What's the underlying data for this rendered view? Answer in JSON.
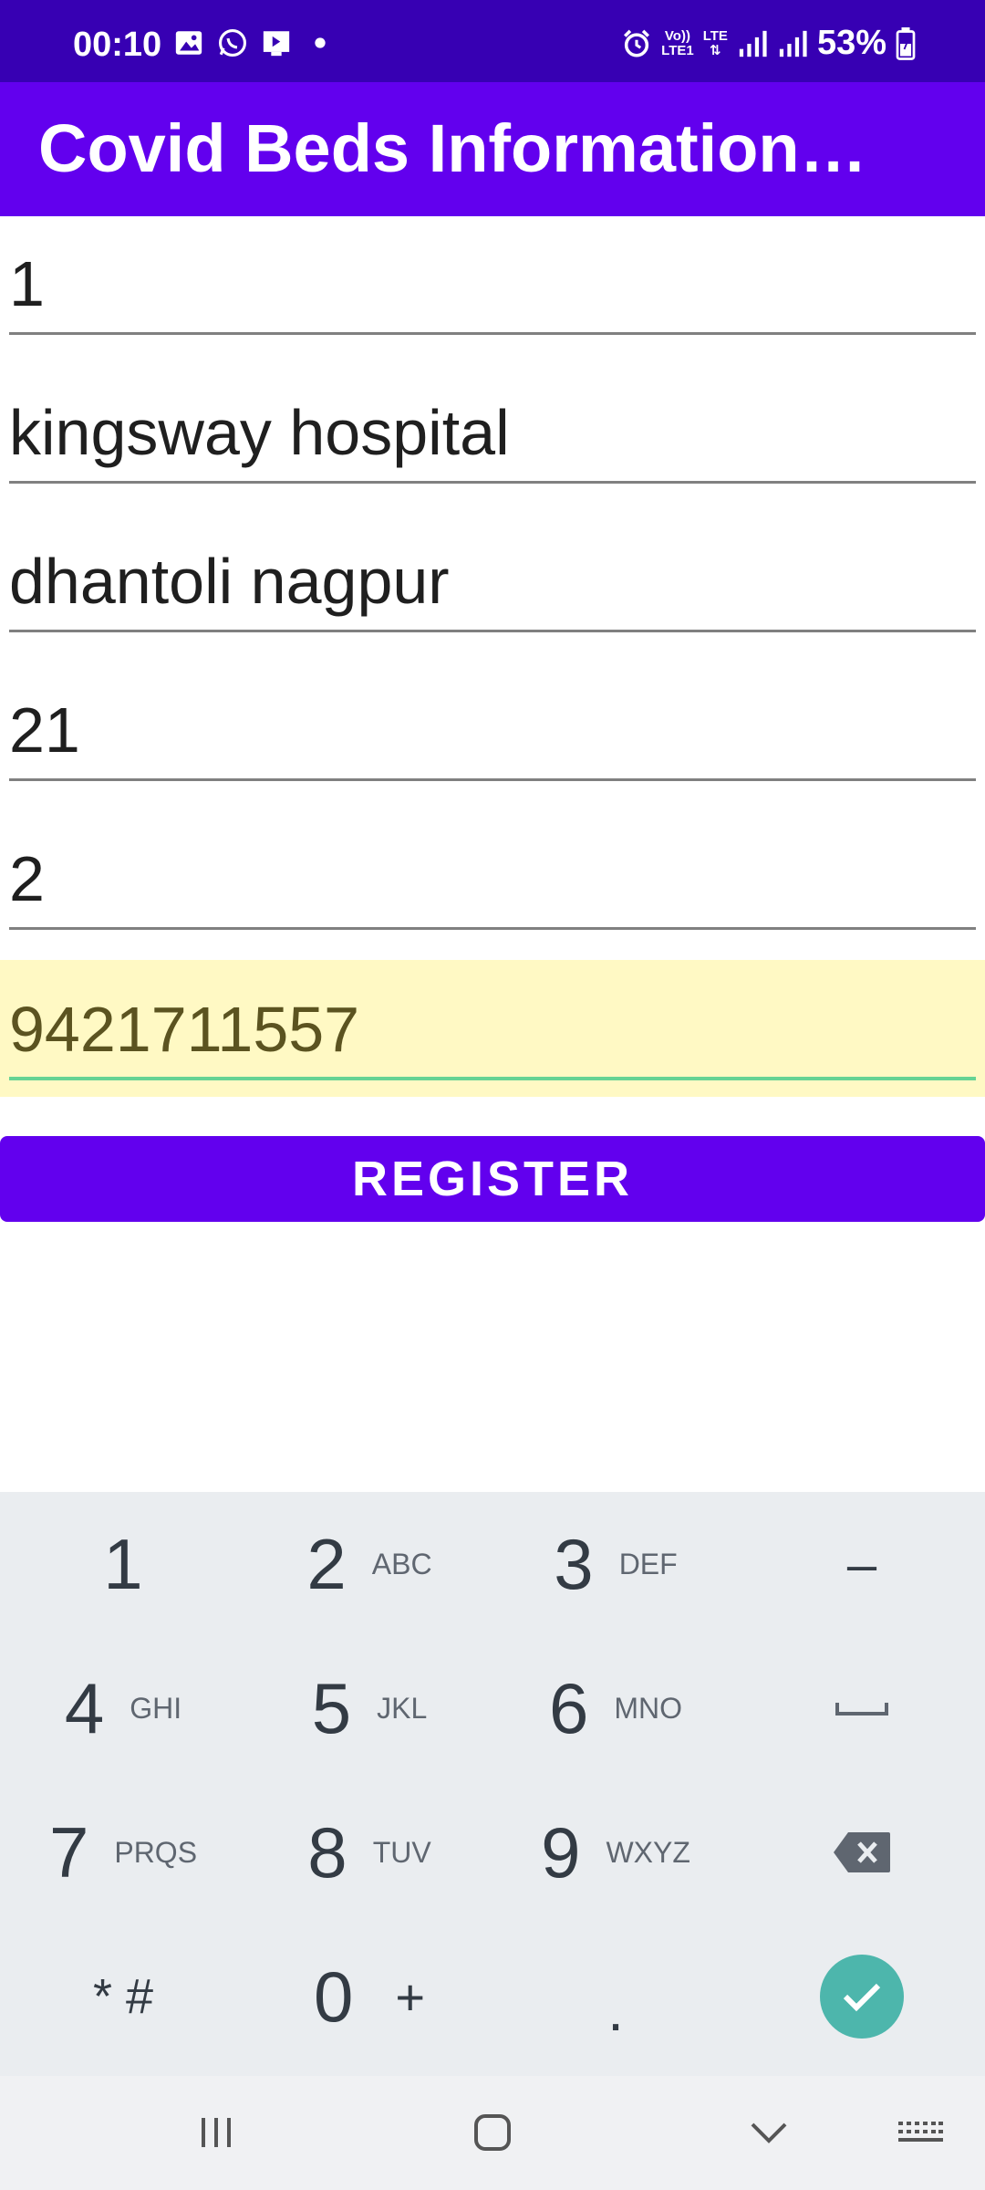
{
  "status_bar": {
    "time": "00:10",
    "battery": "53%",
    "net_top": "Vo))",
    "net_bottom": "LTE1",
    "lte": "LTE",
    "icons": [
      "gallery-icon",
      "whatsapp-icon",
      "media-icon",
      "dot-icon",
      "alarm-icon",
      "volte-icon",
      "signal-icon",
      "signal-icon",
      "battery-icon"
    ]
  },
  "app_bar": {
    "title": "Covid Beds Information…"
  },
  "form": {
    "fields": [
      {
        "value": "1"
      },
      {
        "value": "kingsway hospital"
      },
      {
        "value": "dhantoli nagpur"
      },
      {
        "value": "21"
      },
      {
        "value": "2"
      },
      {
        "value": "9421711557"
      }
    ],
    "register_label": "REGISTER"
  },
  "keyboard": {
    "keys": [
      {
        "digit": "1",
        "letters": ""
      },
      {
        "digit": "2",
        "letters": "ABC"
      },
      {
        "digit": "3",
        "letters": "DEF"
      },
      {
        "digit": "–",
        "letters": ""
      },
      {
        "digit": "4",
        "letters": "GHI"
      },
      {
        "digit": "5",
        "letters": "JKL"
      },
      {
        "digit": "6",
        "letters": "MNO"
      },
      {
        "digit": "7",
        "letters": "PRQS"
      },
      {
        "digit": "8",
        "letters": "TUV"
      },
      {
        "digit": "9",
        "letters": "WXYZ"
      },
      {
        "digit": "* #",
        "letters": ""
      },
      {
        "digit": "0",
        "letters": "+"
      },
      {
        "digit": ".",
        "letters": ""
      }
    ],
    "accent_color": "#4db6ac"
  },
  "colors": {
    "status_bar": "#3700b3",
    "primary": "#6200ee",
    "active_field_bg": "#fff9c4",
    "active_underline": "#66d394"
  }
}
